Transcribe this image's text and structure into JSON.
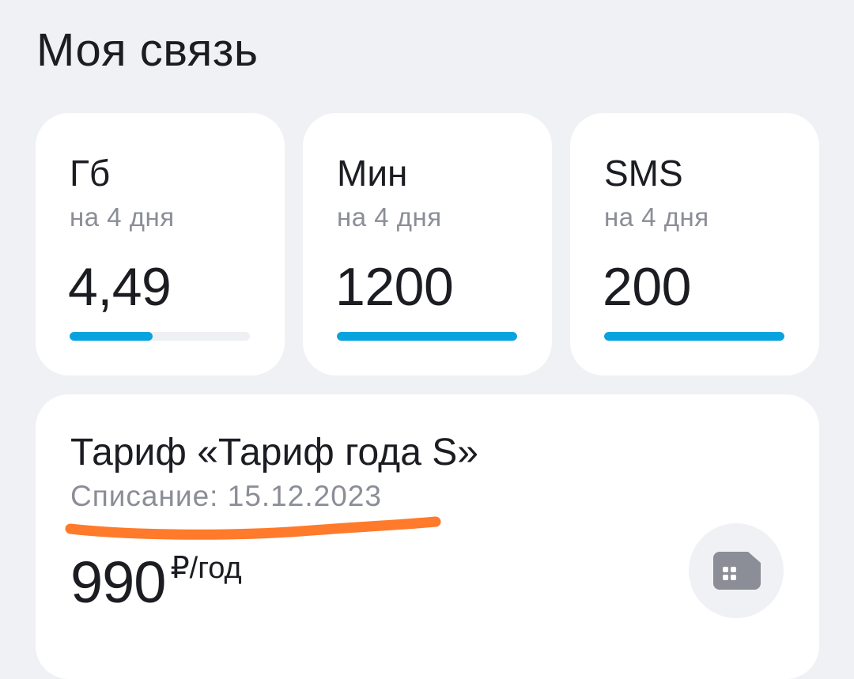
{
  "page": {
    "title": "Моя связь"
  },
  "balances": [
    {
      "unit": "Гб",
      "period": "на 4 дня",
      "value": "4,49",
      "progress": 0.46
    },
    {
      "unit": "Мин",
      "period": "на 4 дня",
      "value": "1200",
      "progress": 1.0
    },
    {
      "unit": "SMS",
      "period": "на 4 дня",
      "value": "200",
      "progress": 1.0
    }
  ],
  "tariff": {
    "title": "Тариф «Тариф года S»",
    "charge_label": "Списание: 15.12.2023",
    "price_amount": "990",
    "price_unit": "₽/год",
    "sim_icon": "sim-card-icon"
  },
  "colors": {
    "background": "#f0f1f4",
    "card": "#ffffff",
    "progress": "#07a3de",
    "progress_track": "#eef0f3",
    "muted_text": "#8b8e97",
    "annotation": "#ff7a2a",
    "icon": "#8b8e97"
  }
}
